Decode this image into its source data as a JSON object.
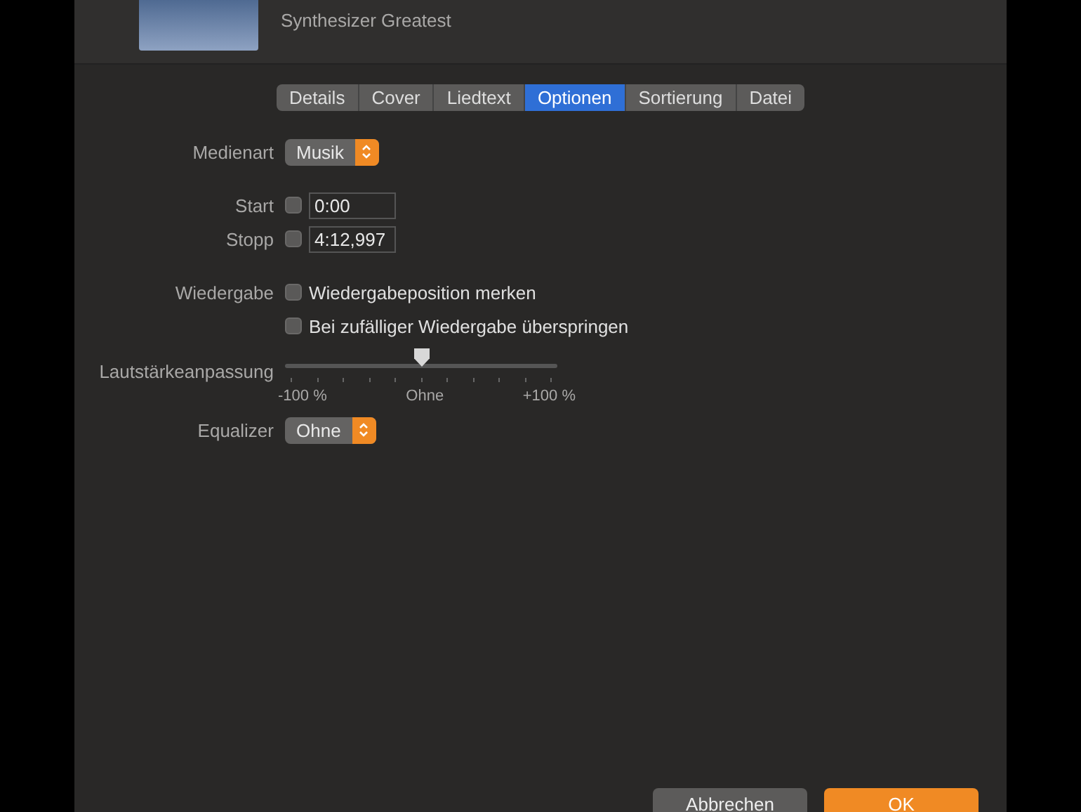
{
  "header": {
    "album": "Synthesizer Greatest"
  },
  "tabs": [
    {
      "label": "Details",
      "selected": false
    },
    {
      "label": "Cover",
      "selected": false
    },
    {
      "label": "Liedtext",
      "selected": false
    },
    {
      "label": "Optionen",
      "selected": true
    },
    {
      "label": "Sortierung",
      "selected": false
    },
    {
      "label": "Datei",
      "selected": false
    }
  ],
  "media_type": {
    "label": "Medienart",
    "value": "Musik"
  },
  "times": [
    {
      "label": "Start",
      "checked": false,
      "value": "0:00"
    },
    {
      "label": "Stopp",
      "checked": false,
      "value": "4:12,997"
    }
  ],
  "playback": {
    "label": "Wiedergabe",
    "options": [
      {
        "label": "Wiedergabeposition merken",
        "checked": false
      },
      {
        "label": "Bei zufälliger Wiedergabe überspringen",
        "checked": false
      }
    ]
  },
  "volume": {
    "label": "Lautstärkeanpassung",
    "level": 0.5,
    "min_label": "-100 %",
    "mid_label": "Ohne",
    "max_label": "+100 %"
  },
  "equalizer": {
    "label": "Equalizer",
    "value": "Ohne"
  },
  "buttons": [
    {
      "label": "Abbrechen",
      "kind": "cancel"
    },
    {
      "label": "OK",
      "kind": "default"
    }
  ]
}
